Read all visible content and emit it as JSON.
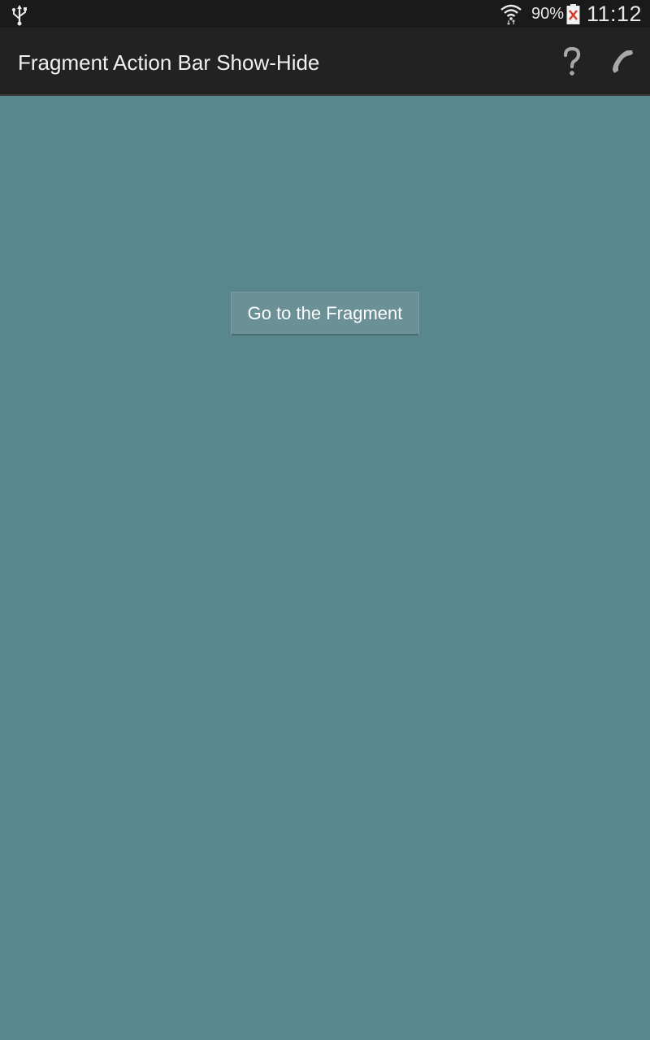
{
  "status_bar": {
    "battery_percent": "90%",
    "time": "11:12",
    "icons": [
      "usb-icon",
      "wifi-icon",
      "battery-icon"
    ]
  },
  "action_bar": {
    "title": "Fragment Action Bar Show-Hide",
    "actions": [
      {
        "name": "help",
        "icon": "help-icon",
        "glyph": "?"
      },
      {
        "name": "call",
        "icon": "phone-icon"
      }
    ]
  },
  "main": {
    "button_label": "Go to the Fragment"
  },
  "colors": {
    "status_bar_bg": "#1a1a1a",
    "action_bar_bg": "#222222",
    "content_bg": "#58888d",
    "button_bg": "#6b9196"
  }
}
